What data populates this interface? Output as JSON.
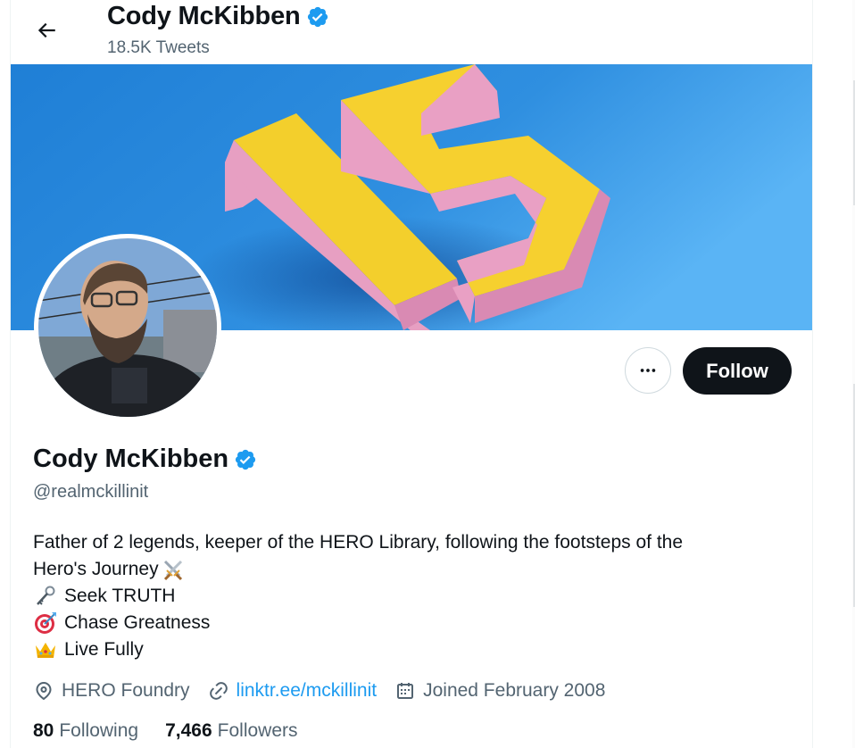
{
  "header": {
    "name": "Cody McKibben",
    "tweet_count": "18.5K Tweets",
    "verified": true
  },
  "profile": {
    "display_name": "Cody McKibben",
    "handle": "@realmckillinit",
    "bio": {
      "line1": "Father of 2 legends, keeper of the HERO Library, following the footsteps of the",
      "line2": "Hero's Journey",
      "line3": "Seek TRUTH",
      "line4": "Chase Greatness",
      "line5": "Live Fully"
    },
    "location": "HERO Foundry",
    "website": "linktr.ee/mckillinit",
    "joined": "Joined February 2008",
    "following_count": "80",
    "following_label": "Following",
    "followers_count": "7,466",
    "followers_label": "Followers"
  },
  "actions": {
    "follow_label": "Follow"
  },
  "icons": {
    "back": "arrow-left-icon",
    "verified": "verified-badge-icon",
    "more": "more-dots-icon",
    "location": "location-pin-icon",
    "link": "link-icon",
    "calendar": "calendar-icon",
    "swords": "crossed-swords-emoji",
    "key": "key-emoji",
    "target": "target-emoji",
    "crown": "crown-emoji"
  },
  "colors": {
    "accent": "#1d9bf0",
    "text_primary": "#0f1419",
    "text_secondary": "#536471",
    "follow_bg": "#0f1419",
    "banner_blue": "#2f8fe0",
    "banner_yellow": "#f6d02f",
    "banner_pink": "#e9a0c4"
  }
}
